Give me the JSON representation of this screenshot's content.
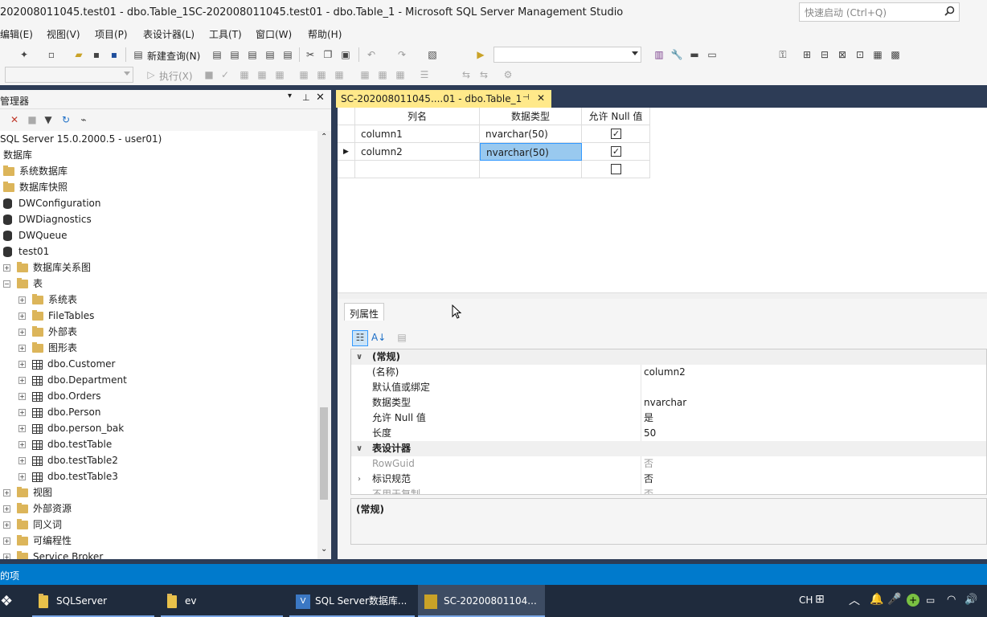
{
  "window": {
    "title": "202008011045.test01 - dbo.Table_1SC-202008011045.test01 - dbo.Table_1 - Microsoft SQL Server Management Studio",
    "quick_launch_placeholder": "快速启动 (Ctrl+Q)"
  },
  "menu": [
    "编辑(E)",
    "视图(V)",
    "项目(P)",
    "表设计器(L)",
    "工具(T)",
    "窗口(W)",
    "帮助(H)"
  ],
  "toolbar": {
    "new_query": "新建查询(N)",
    "execute": "执行(X)"
  },
  "object_explorer": {
    "title": "管理器",
    "server": "SQL Server 15.0.2000.5 - user01)",
    "items": [
      {
        "label": "数据库",
        "icon": "folder-icon"
      },
      {
        "label": "系统数据库",
        "icon": "folder-icon"
      },
      {
        "label": "数据库快照",
        "icon": "folder-icon"
      },
      {
        "label": "DWConfiguration",
        "icon": "database-icon"
      },
      {
        "label": "DWDiagnostics",
        "icon": "database-icon"
      },
      {
        "label": "DWQueue",
        "icon": "database-icon"
      },
      {
        "label": "test01",
        "icon": "database-icon"
      },
      {
        "label": "数据库关系图",
        "icon": "folder-icon"
      },
      {
        "label": "表",
        "icon": "folder-icon"
      },
      {
        "label": "系统表",
        "icon": "folder-icon"
      },
      {
        "label": "FileTables",
        "icon": "folder-icon"
      },
      {
        "label": "外部表",
        "icon": "folder-icon"
      },
      {
        "label": "图形表",
        "icon": "folder-icon"
      },
      {
        "label": "dbo.Customer",
        "icon": "table-icon"
      },
      {
        "label": "dbo.Department",
        "icon": "table-icon"
      },
      {
        "label": "dbo.Orders",
        "icon": "table-icon"
      },
      {
        "label": "dbo.Person",
        "icon": "table-icon"
      },
      {
        "label": "dbo.person_bak",
        "icon": "table-icon"
      },
      {
        "label": "dbo.testTable",
        "icon": "table-icon"
      },
      {
        "label": "dbo.testTable2",
        "icon": "table-icon"
      },
      {
        "label": "dbo.testTable3",
        "icon": "table-icon"
      },
      {
        "label": "视图",
        "icon": "folder-icon"
      },
      {
        "label": "外部资源",
        "icon": "folder-icon"
      },
      {
        "label": "同义词",
        "icon": "folder-icon"
      },
      {
        "label": "可编程性",
        "icon": "folder-icon"
      },
      {
        "label": "Service Broker",
        "icon": "folder-icon"
      }
    ]
  },
  "document_tab": {
    "label": "SC-202008011045....01 - dbo.Table_1"
  },
  "designer": {
    "headers": [
      "列名",
      "数据类型",
      "允许 Null 值"
    ],
    "rows": [
      {
        "name": "column1",
        "type": "nvarchar(50)",
        "allow_null": true
      },
      {
        "name": "column2",
        "type": "nvarchar(50)",
        "allow_null": true
      },
      {
        "name": "",
        "type": "",
        "allow_null": false
      }
    ]
  },
  "properties": {
    "tab": "列属性",
    "rows": [
      {
        "name": "(常规)",
        "value": "",
        "category": true
      },
      {
        "name": "(名称)",
        "value": "column2"
      },
      {
        "name": "默认值或绑定",
        "value": ""
      },
      {
        "name": "数据类型",
        "value": "nvarchar"
      },
      {
        "name": "允许 Null 值",
        "value": "是"
      },
      {
        "name": "长度",
        "value": "50"
      },
      {
        "name": "表设计器",
        "value": "",
        "category": true
      },
      {
        "name": "RowGuid",
        "value": "否",
        "disabled": true
      },
      {
        "name": "标识规范",
        "value": "否"
      },
      {
        "name": "不用于复制",
        "value": "否",
        "disabled": true
      }
    ],
    "description": "(常规)"
  },
  "status": {
    "text": "的项"
  },
  "taskbar": {
    "items": [
      "SQLServer",
      "ev",
      "SQL Server数据库...",
      "SC-20200801104..."
    ],
    "ime": "CH"
  }
}
